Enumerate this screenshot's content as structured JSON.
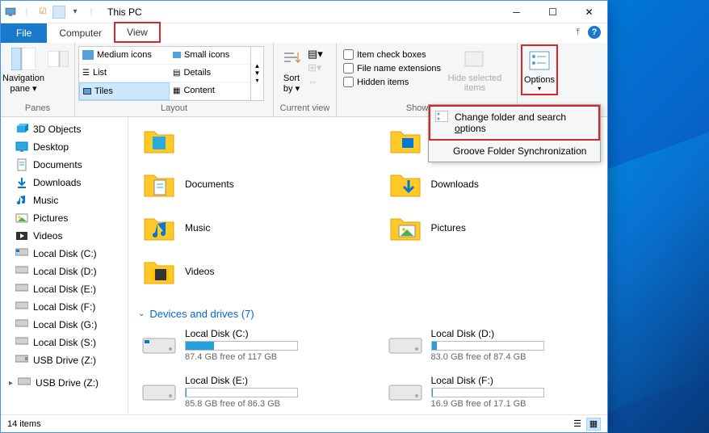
{
  "title": "This PC",
  "tabs": {
    "file": "File",
    "computer": "Computer",
    "view": "View"
  },
  "ribbon": {
    "panes_group": "Panes",
    "nav_pane": "Navigation\npane",
    "layout_group": "Layout",
    "layout": {
      "medium": "Medium icons",
      "small": "Small icons",
      "list": "List",
      "details": "Details",
      "tiles": "Tiles",
      "content": "Content"
    },
    "current_view_group": "Current view",
    "sort_by": "Sort\nby",
    "showhide_group": "Show/hide",
    "checks": {
      "item_cb": "Item check boxes",
      "fne": "File name extensions",
      "hidden": "Hidden items"
    },
    "hide_selected": "Hide selected\nitems",
    "options": "Options"
  },
  "dropdown": {
    "change": "Change folder and search options",
    "underline_part": "o",
    "groove": "Groove Folder Synchronization"
  },
  "nav": [
    "3D Objects",
    "Desktop",
    "Documents",
    "Downloads",
    "Music",
    "Pictures",
    "Videos",
    "Local Disk (C:)",
    "Local Disk (D:)",
    "Local Disk (E:)",
    "Local Disk (F:)",
    "Local Disk (G:)",
    "Local Disk (S:)",
    "USB Drive (Z:)",
    "USB Drive (Z:)"
  ],
  "folders": [
    "Documents",
    "Downloads",
    "Music",
    "Pictures",
    "Videos"
  ],
  "section": "Devices and drives (7)",
  "drives": [
    {
      "name": "Local Disk (C:)",
      "free": "87.4 GB free of 117 GB",
      "pct": 25
    },
    {
      "name": "Local Disk (D:)",
      "free": "83.0 GB free of 87.4 GB",
      "pct": 5
    },
    {
      "name": "Local Disk (E:)",
      "free": "85.8 GB free of 86.3 GB",
      "pct": 1
    },
    {
      "name": "Local Disk (F:)",
      "free": "16.9 GB free of 17.1 GB",
      "pct": 1
    }
  ],
  "status": "14 items"
}
